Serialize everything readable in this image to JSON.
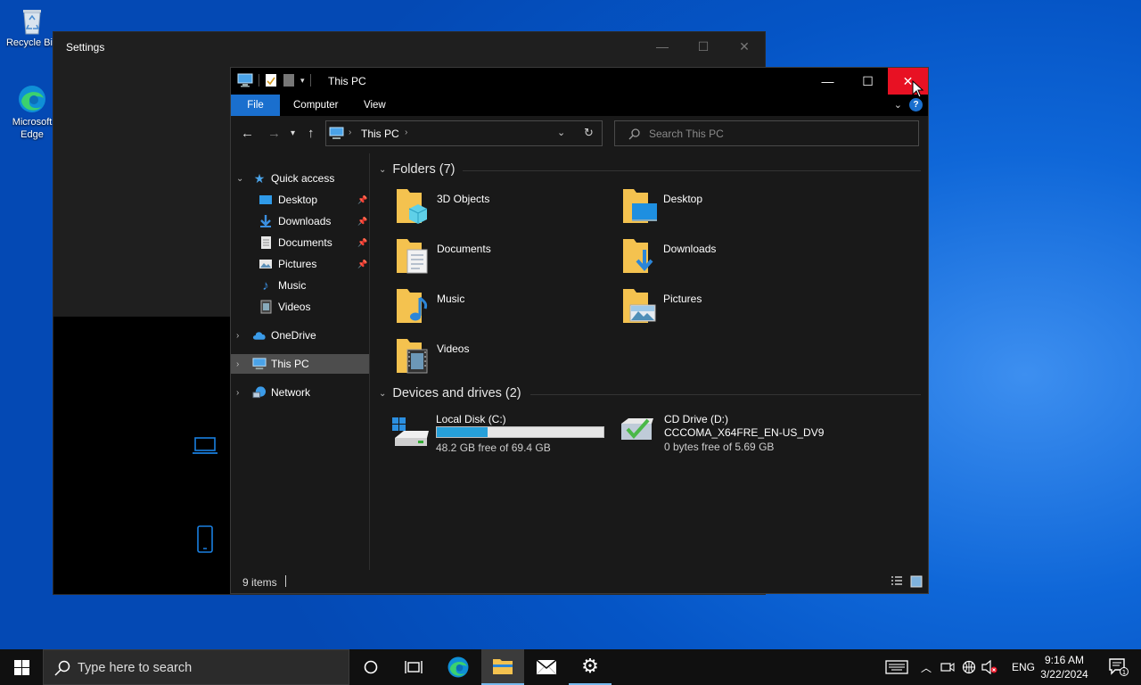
{
  "desktop": {
    "icons": [
      {
        "label": "Recycle Bin",
        "icon": "recycle-bin-icon"
      },
      {
        "label": "Microsoft Edge",
        "icon": "edge-icon"
      }
    ]
  },
  "settings_window": {
    "title": "Settings",
    "minimize": "—",
    "maximize": "☐",
    "close": "✕"
  },
  "explorer": {
    "title": "This PC",
    "caption": {
      "minimize": "—",
      "maximize": "☐",
      "close": "✕"
    },
    "ribbon_tabs": [
      "File",
      "Computer",
      "View"
    ],
    "help": "?",
    "address": {
      "crumb": "This PC"
    },
    "search": {
      "placeholder": "Search This PC"
    },
    "nav": {
      "quick_access": "Quick access",
      "items": [
        "Desktop",
        "Downloads",
        "Documents",
        "Pictures",
        "Music",
        "Videos"
      ],
      "onedrive": "OneDrive",
      "this_pc": "This PC",
      "network": "Network"
    },
    "folders_header": "Folders (7)",
    "folders": [
      "3D Objects",
      "Desktop",
      "Documents",
      "Downloads",
      "Music",
      "Pictures",
      "Videos"
    ],
    "drives_header": "Devices and drives (2)",
    "drives": [
      {
        "name": "Local Disk (C:)",
        "free": "48.2 GB free of 69.4 GB",
        "used_fraction": 0.305
      },
      {
        "name": "CD Drive (D:)",
        "label": "CCCOMA_X64FRE_EN-US_DV9",
        "free": "0 bytes free of 5.69 GB"
      }
    ],
    "status": "9 items"
  },
  "taskbar": {
    "search_placeholder": "Type here to search",
    "lang": "ENG",
    "time": "9:16 AM",
    "date": "3/22/2024"
  },
  "colors": {
    "accent": "#1a6fce",
    "close_red": "#e81123",
    "progress": "#26a0da",
    "folder": "#f4c24f"
  }
}
